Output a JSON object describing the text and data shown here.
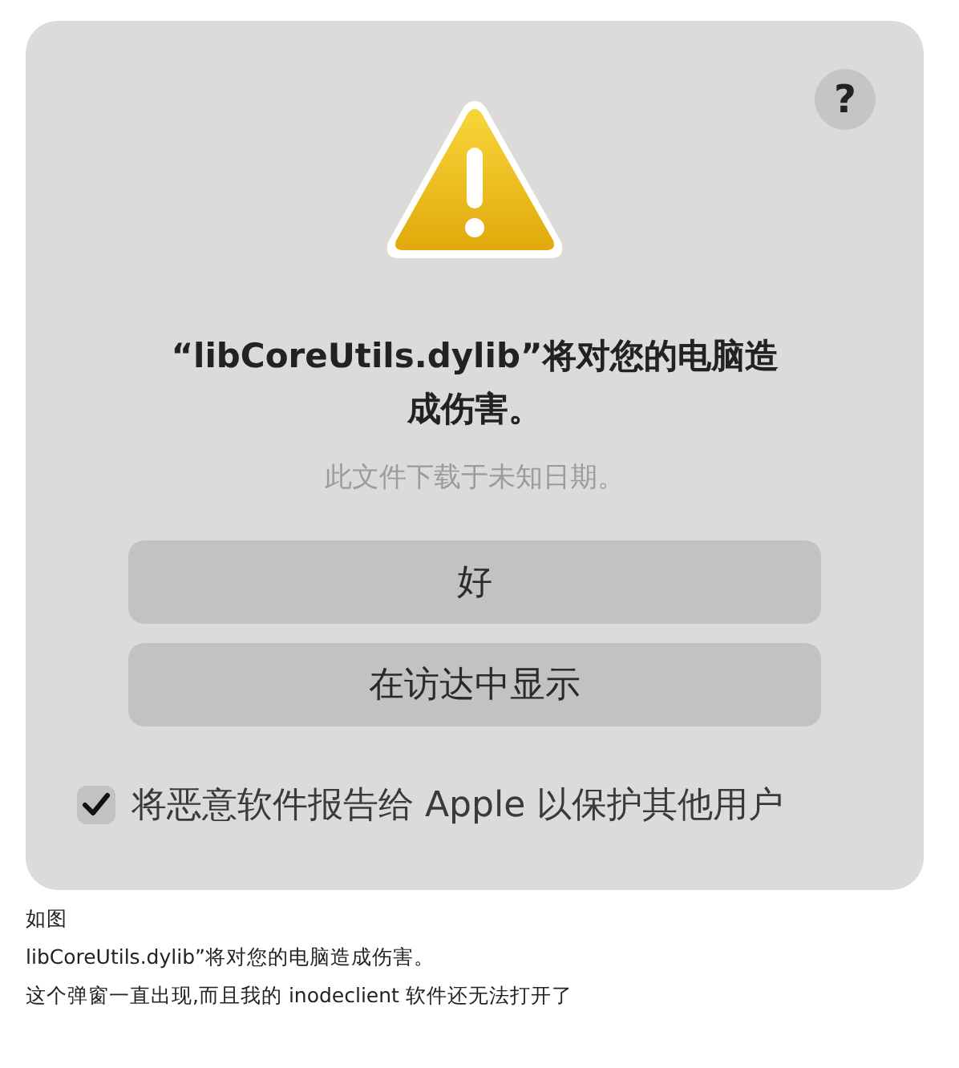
{
  "dialog": {
    "help_button": "?",
    "title": "“libCoreUtils.dylib”将对您的电脑造成伤害。",
    "message": "此文件下载于未知日期。",
    "buttons": [
      "好",
      "在访达中显示"
    ],
    "report_checkbox": {
      "label": "将恶意软件报告给 Apple 以保护其他用户",
      "checked": true
    }
  },
  "post_lines": [
    "如图",
    "libCoreUtils.dylib”将对您的电脑造成伤害。",
    "这个弹窗一直出现,而且我的 inodeclient 软件还无法打开了"
  ]
}
